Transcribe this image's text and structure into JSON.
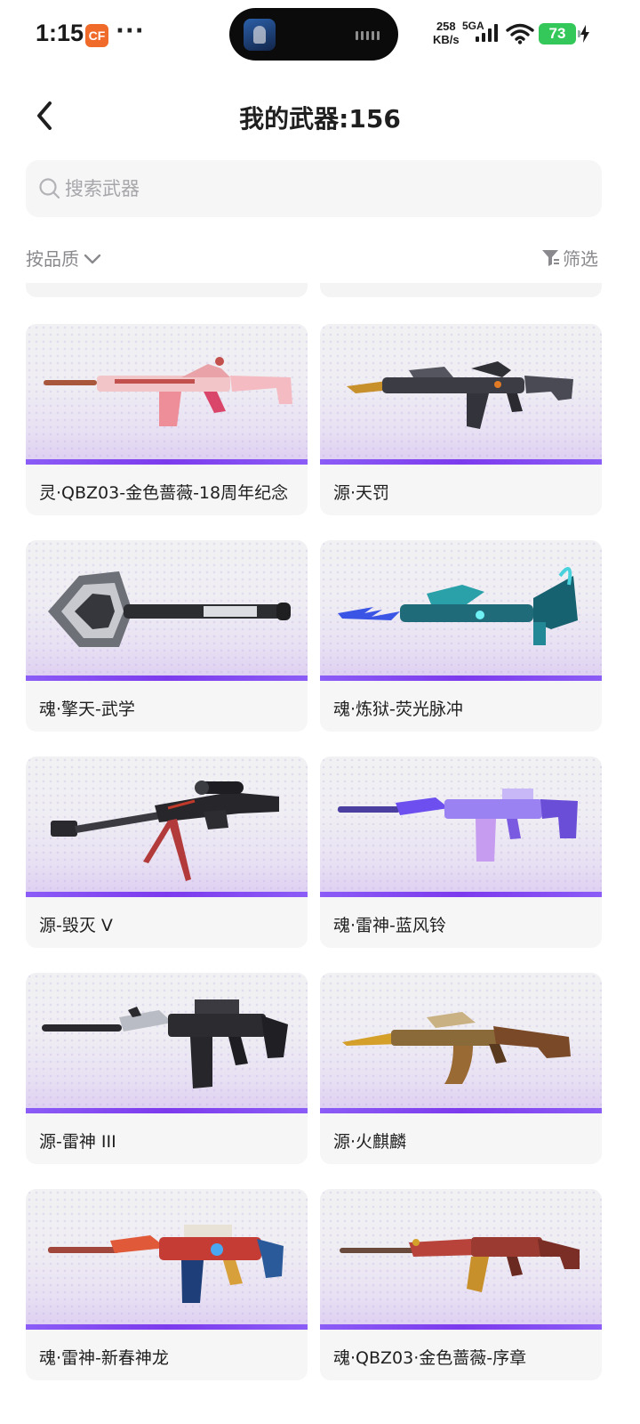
{
  "status_bar": {
    "time": "1:15",
    "app_badge": "CF",
    "dots": "···",
    "net_speed_value": "258",
    "net_speed_unit": "KB/s",
    "network_type": "5GA",
    "battery_level": "73",
    "battery_color": "#34c759"
  },
  "header": {
    "back_icon": "chevron-left-icon",
    "title": "我的武器:156"
  },
  "search": {
    "placeholder": "搜索武器",
    "value": "",
    "icon": "search-icon"
  },
  "filters": {
    "quality_sort_label": "按品质",
    "quality_sort_icon": "chevron-down-icon",
    "filter_label": "筛选",
    "filter_icon": "funnel-icon"
  },
  "accent_color": "#7c3aed",
  "weapons": [
    {
      "name": "灵·QBZ03-金色蔷薇-18周年纪念",
      "icon": "rifle-pink-rose-icon"
    },
    {
      "name": "源·天罚",
      "icon": "rifle-dark-bayonet-icon"
    },
    {
      "name": "魂·擎天-武学",
      "icon": "shovel-melee-icon"
    },
    {
      "name": "魂·炼狱-荧光脉冲",
      "icon": "dragon-rifle-cyan-icon"
    },
    {
      "name": "源-毁灭 V",
      "icon": "sniper-rifle-red-icon"
    },
    {
      "name": "魂·雷神-蓝风铃",
      "icon": "rifle-purple-icon"
    },
    {
      "name": "源-雷神 III",
      "icon": "rifle-black-silver-icon"
    },
    {
      "name": "源·火麒麟",
      "icon": "rifle-gold-kylin-icon"
    },
    {
      "name": "魂·雷神-新春神龙",
      "icon": "rifle-red-dragon-icon"
    },
    {
      "name": "魂·QBZ03·金色蔷薇-序章",
      "icon": "rifle-red-gold-icon"
    }
  ]
}
